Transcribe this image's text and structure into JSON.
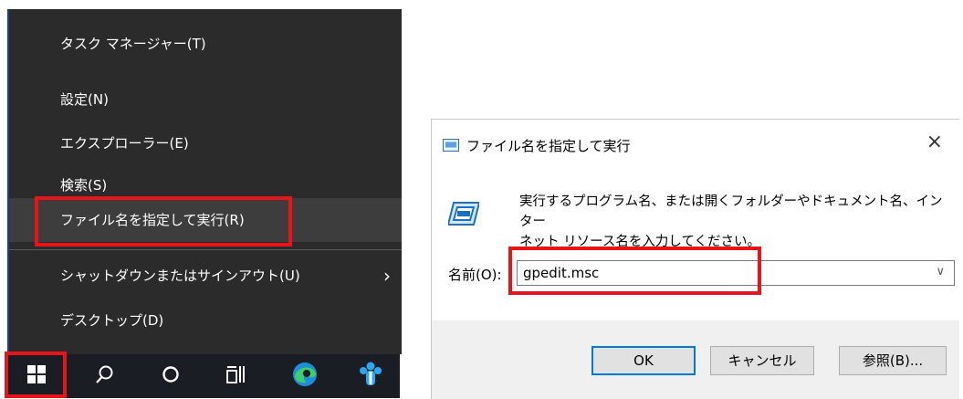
{
  "winx_menu": {
    "items": [
      {
        "label": "タスク マネージャー(T)"
      },
      {
        "label": "設定(N)"
      },
      {
        "label": "エクスプローラー(E)"
      },
      {
        "label": "検索(S)"
      },
      {
        "label": "ファイル名を指定して実行(R)"
      },
      {
        "label": "シャットダウンまたはサインアウト(U)"
      },
      {
        "label": "デスクトップ(D)"
      }
    ],
    "submenu_arrow": "›"
  },
  "taskbar": {
    "icons": [
      "windows-start-icon",
      "search-icon",
      "cortana-icon",
      "task-view-icon",
      "edge-icon",
      "app-icon"
    ]
  },
  "run_dialog": {
    "title": "ファイル名を指定して実行",
    "close": "×",
    "description_line1": "実行するプログラム名、または開くフォルダーやドキュメント名、インター",
    "description_line2": "ネット リソース名を入力してください。",
    "name_label": "名前(O):",
    "name_value": "gpedit.msc",
    "dropdown_arrow": "∨",
    "ok_label": "OK",
    "cancel_label": "キャンセル",
    "browse_label": "参照(B)..."
  },
  "colors": {
    "menu_bg": "#2b2b2b",
    "taskbar_bg": "#1a1d24",
    "highlight": "#e8141b",
    "accent": "#0078d7"
  }
}
